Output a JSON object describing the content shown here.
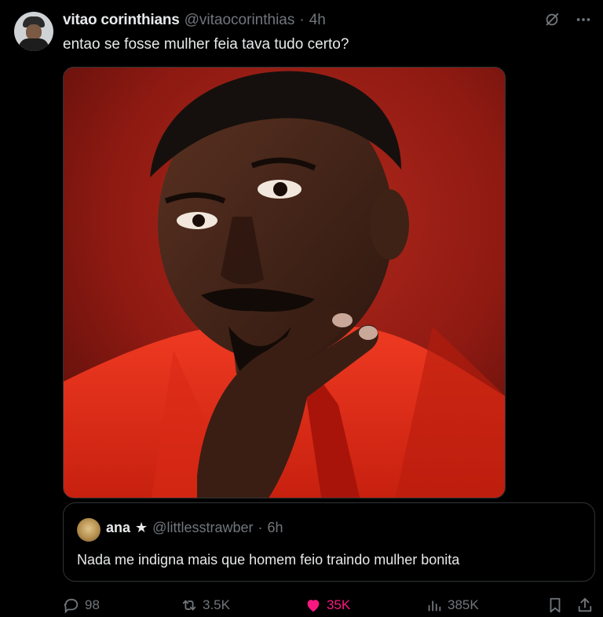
{
  "tweet": {
    "author": {
      "name": "vitao corinthians",
      "handle": "@vitaocorinthias",
      "separator": "·",
      "time": "4h",
      "avatar_icon": "profile-avatar"
    },
    "text": "entao se fosse mulher feia tava tudo certo?",
    "top_icons": [
      "grok-icon",
      "more-icon"
    ],
    "media": {
      "kind": "photo",
      "subject": "portrait of a man in a red suit against a red background"
    },
    "quote": {
      "author": {
        "name": "ana",
        "badge": "★",
        "handle": "@littlesstrawber",
        "separator": "·",
        "time": "6h"
      },
      "text": "Nada me indigna mais que homem feio traindo mulher bonita"
    },
    "actions": {
      "replies": "98",
      "reposts": "3.5K",
      "likes": "35K",
      "views": "385K"
    }
  },
  "colors": {
    "background": "#000000",
    "text": "#e7e9ea",
    "muted": "#71767b",
    "border": "#2f3336",
    "like": "#f91880"
  }
}
